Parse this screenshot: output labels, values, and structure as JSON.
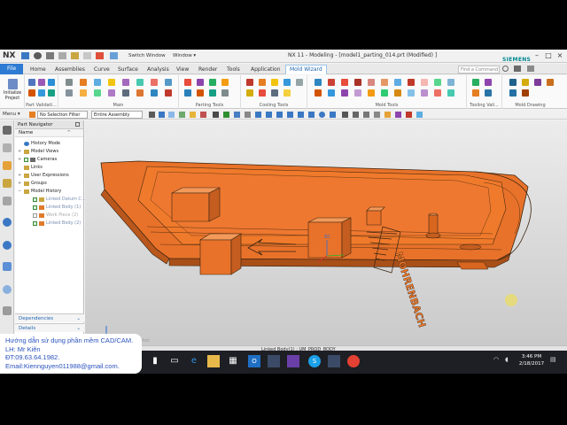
{
  "window": {
    "app_logo": "NX",
    "switch_window": "Switch Window",
    "window_menu": "Window ▾",
    "title": "NX 11 - Modeling - [model1_parting_014.prt (Modified) ]",
    "brand": "SIEMENS",
    "controls": [
      "–",
      "□",
      "×"
    ]
  },
  "tabs": [
    {
      "label": "File"
    },
    {
      "label": "Home"
    },
    {
      "label": "Assemblies"
    },
    {
      "label": "Curve"
    },
    {
      "label": "Surface"
    },
    {
      "label": "Analysis"
    },
    {
      "label": "View"
    },
    {
      "label": "Render"
    },
    {
      "label": "Tools"
    },
    {
      "label": "Application"
    },
    {
      "label": "Mold Wizard"
    }
  ],
  "command_finder": {
    "placeholder": "Find a Command"
  },
  "ribbon": {
    "left_tool": "Initialize Project",
    "groups": [
      "Part Validati...",
      "Main",
      "Parting Tools",
      "Cooling Tools",
      "Mold Tools",
      "Tooling Vali...",
      "Mold Drawing"
    ]
  },
  "selection_bar": {
    "menu": "Menu ▾",
    "filter": "No Selection Filter",
    "scope": "Entire Assembly"
  },
  "navigator": {
    "title": "Part Navigator",
    "column": "Name",
    "nodes": [
      {
        "label": "History Mode",
        "icon": "history-icon"
      },
      {
        "label": "Model Views",
        "icon": "model-views-icon"
      },
      {
        "label": "Cameras",
        "icon": "camera-icon"
      },
      {
        "label": "Links",
        "icon": "links-icon"
      },
      {
        "label": "User Expressions",
        "icon": "expressions-icon"
      },
      {
        "label": "Groups",
        "icon": "groups-icon"
      },
      {
        "label": "Model History",
        "icon": "model-history-icon"
      },
      {
        "label": "Linked Datum C...",
        "icon": "datum-icon"
      },
      {
        "label": "Linked Body (1)",
        "icon": "body-icon"
      },
      {
        "label": "Work Piece (2)",
        "icon": "body-icon"
      },
      {
        "label": "Linked Body (2)",
        "icon": "body-icon"
      }
    ],
    "dependencies": "Dependencies",
    "details": "Details"
  },
  "status": {
    "text": "Linked Body(1) : UM_PROD_BODY",
    "graph_text": "a Isometric"
  },
  "model": {
    "part_color": "#f07a2b",
    "engraving": "MOHRENBACH",
    "coord_label": "ZC"
  },
  "taskbar": {
    "clock_time": "3:46 PM",
    "clock_date": "2/18/2017"
  },
  "caption": {
    "line1": "Hướng dẫn sử dụng phần mềm CAD/CAM.",
    "line2": "LH: Mr Kiên",
    "line3": "ĐT:09.63.64.1982.",
    "line4": "Email:Kiennguyen011988@gmail.com."
  }
}
